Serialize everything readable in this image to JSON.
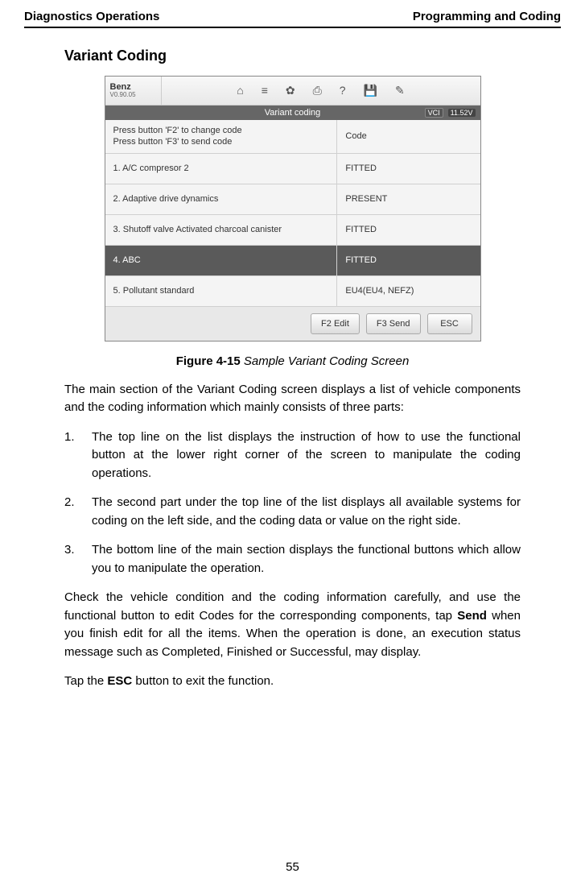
{
  "header": {
    "left": "Diagnostics Operations",
    "right": "Programming and Coding"
  },
  "section_title": "Variant Coding",
  "screenshot": {
    "brand": {
      "name": "Benz",
      "version": "V0.90.05"
    },
    "top_icons": [
      "home-icon",
      "menu-icon",
      "gear-icon",
      "print-icon",
      "help-icon",
      "save-icon",
      "edit-icon"
    ],
    "title": "Variant coding",
    "vci": "VCI",
    "voltage": "11.52V",
    "instruction": {
      "left_line1": "Press button 'F2' to change code",
      "left_line2": "Press button 'F3' to send code",
      "right": "Code"
    },
    "rows": [
      {
        "label": "1. A/C compresor 2",
        "value": "FITTED",
        "selected": false
      },
      {
        "label": "2. Adaptive drive dynamics",
        "value": "PRESENT",
        "selected": false
      },
      {
        "label": "3. Shutoff valve Activated charcoal canister",
        "value": "FITTED",
        "selected": false
      },
      {
        "label": "4. ABC",
        "value": "FITTED",
        "selected": true
      },
      {
        "label": "5. Pollutant standard",
        "value": "EU4(EU4, NEFZ)",
        "selected": false
      }
    ],
    "buttons": {
      "f2": "F2 Edit",
      "f3": "F3 Send",
      "esc": "ESC"
    }
  },
  "caption": {
    "label": "Figure 4-15",
    "title": " Sample Variant Coding Screen"
  },
  "paragraphs": {
    "intro": "The main section of the Variant Coding screen displays a list of vehicle components and the coding information which mainly consists of three parts:",
    "item1": "The top line on the list displays the instruction of how to use the functional button at the lower right corner of the screen to manipulate the coding operations.",
    "item2": "The second part under the top line of the list displays all available systems for coding on the left side, and the coding data or value on the right side.",
    "item3": "The bottom line of the main section displays the functional buttons which allow you to manipulate the operation.",
    "check_pre": "Check the vehicle condition and the coding information carefully, and use the functional button to edit Codes for the corresponding components, tap ",
    "check_send": "Send",
    "check_post": " when you finish edit for all the items. When the operation is done, an execution status message such as Completed, Finished or Successful, may display.",
    "esc_pre": "Tap the ",
    "esc_bold": "ESC",
    "esc_post": " button to exit the function."
  },
  "list_numbers": {
    "n1": "1.",
    "n2": "2.",
    "n3": "3."
  },
  "icon_glyphs": {
    "home-icon": "⌂",
    "menu-icon": "≡",
    "gear-icon": "✿",
    "print-icon": "⎙",
    "help-icon": "?",
    "save-icon": "💾",
    "edit-icon": "✎"
  },
  "page_number": "55"
}
